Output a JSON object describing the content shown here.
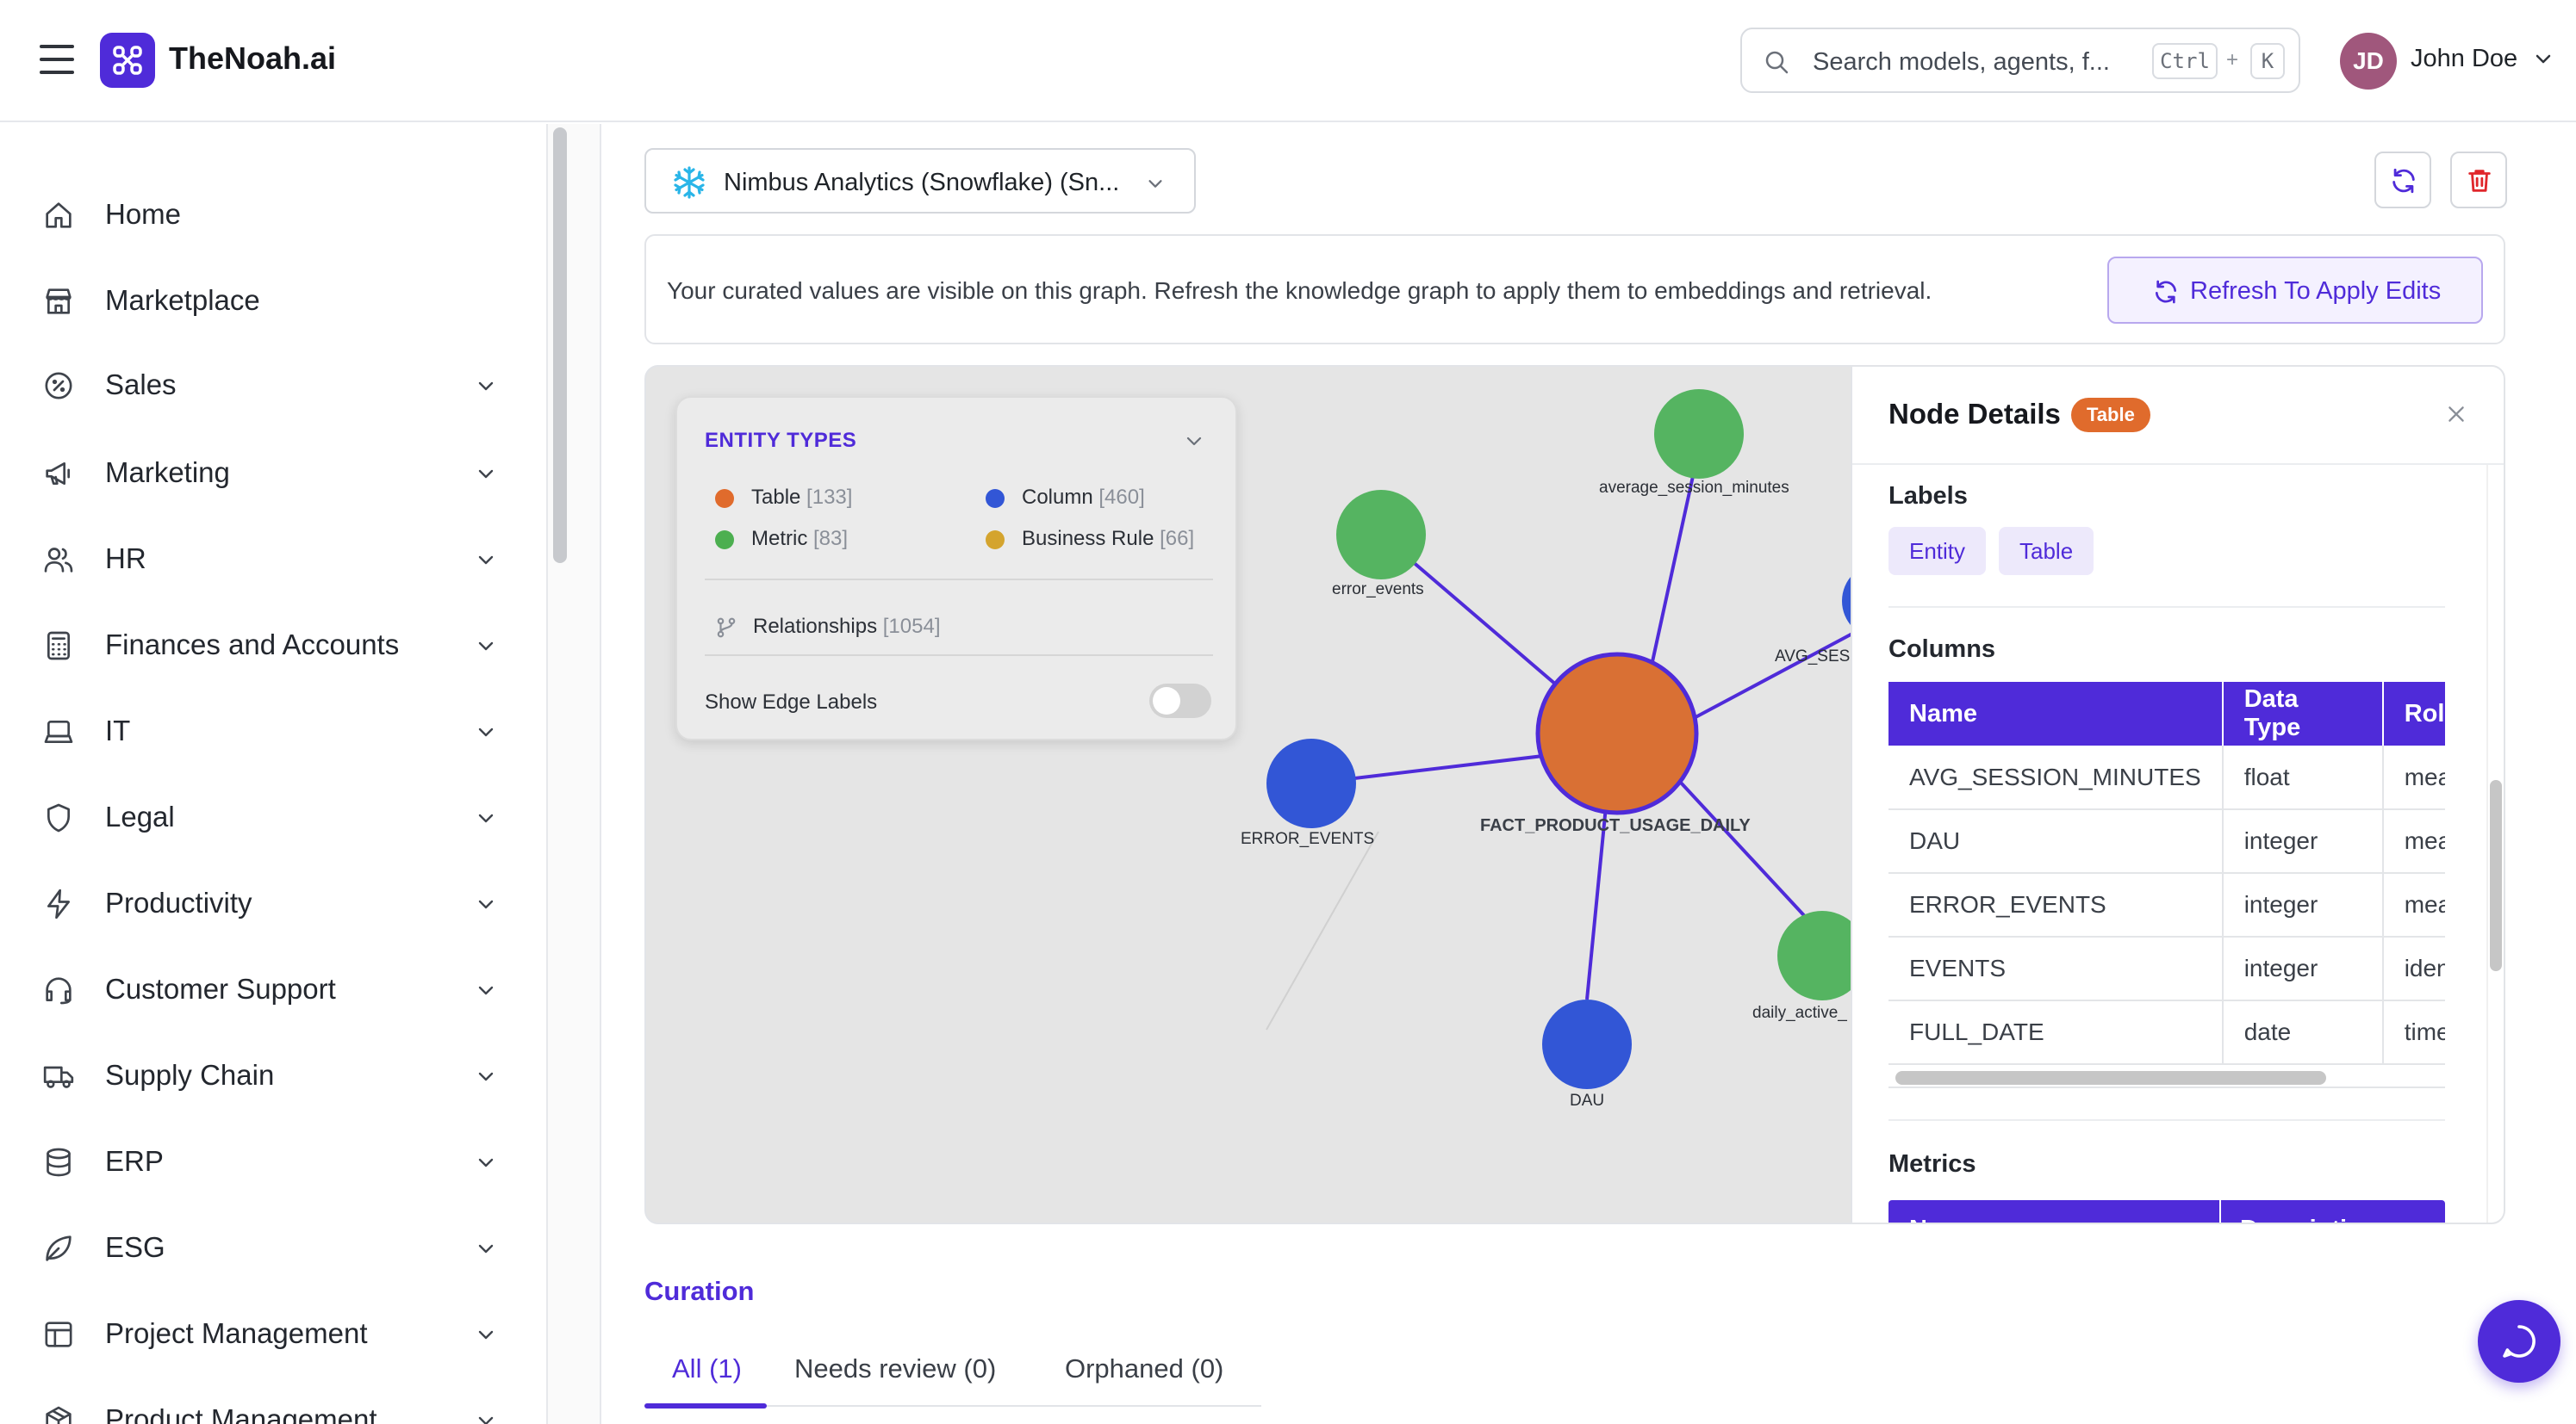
{
  "header": {
    "app_name": "TheNoah.ai",
    "search_placeholder": "Search models, agents, f...",
    "shortcut_ctrl": "Ctrl",
    "shortcut_plus": "+",
    "shortcut_key": "K",
    "user_initials": "JD",
    "user_name": "John Doe"
  },
  "sidebar": {
    "items": [
      {
        "label": "Home",
        "icon": "home-icon",
        "expandable": false
      },
      {
        "label": "Marketplace",
        "icon": "store-icon",
        "expandable": false
      },
      {
        "label": "Sales",
        "icon": "percent-badge-icon",
        "expandable": true
      },
      {
        "label": "Marketing",
        "icon": "megaphone-icon",
        "expandable": true
      },
      {
        "label": "HR",
        "icon": "users-icon",
        "expandable": true
      },
      {
        "label": "Finances and Accounts",
        "icon": "calculator-icon",
        "expandable": true
      },
      {
        "label": "IT",
        "icon": "laptop-icon",
        "expandable": true
      },
      {
        "label": "Legal",
        "icon": "shield-icon",
        "expandable": true
      },
      {
        "label": "Productivity",
        "icon": "lightning-icon",
        "expandable": true
      },
      {
        "label": "Customer Support",
        "icon": "headset-icon",
        "expandable": true
      },
      {
        "label": "Supply Chain",
        "icon": "truck-icon",
        "expandable": true
      },
      {
        "label": "ERP",
        "icon": "database-icon",
        "expandable": true
      },
      {
        "label": "ESG",
        "icon": "leaf-icon",
        "expandable": true
      },
      {
        "label": "Project Management",
        "icon": "layout-icon",
        "expandable": true
      },
      {
        "label": "Product Management",
        "icon": "box-icon",
        "expandable": true
      }
    ]
  },
  "toolbar": {
    "datasource": "Nimbus Analytics (Snowflake) (Sn..."
  },
  "notice": {
    "text": "Your curated values are visible on this graph. Refresh the knowledge graph to apply them to embeddings and retrieval.",
    "button": "Refresh To Apply Edits"
  },
  "legend": {
    "title": "ENTITY TYPES",
    "types": [
      {
        "name": "Table",
        "count": "[133]",
        "color": "#e06b2c"
      },
      {
        "name": "Column",
        "count": "[460]",
        "color": "#3256d6"
      },
      {
        "name": "Metric",
        "count": "[83]",
        "color": "#4caf50"
      },
      {
        "name": "Business Rule",
        "count": "[66]",
        "color": "#d4a42e"
      }
    ],
    "relationships_label": "Relationships",
    "relationships_count": "[1054]",
    "edge_labels_label": "Show Edge Labels",
    "edge_labels_enabled": false
  },
  "graph": {
    "nodes": [
      {
        "label": "FACT_PRODUCT_USAGE_DAILY",
        "type": "Table"
      },
      {
        "label": "average_session_minutes",
        "type": "Metric"
      },
      {
        "label": "error_events",
        "type": "Metric"
      },
      {
        "label": "AVG_SES",
        "type": "Column"
      },
      {
        "label": "ERROR_EVENTS",
        "type": "Column"
      },
      {
        "label": "daily_active_",
        "type": "Metric"
      },
      {
        "label": "DAU",
        "type": "Column"
      }
    ]
  },
  "details": {
    "title": "Node Details",
    "badge": "Table",
    "labels_title": "Labels",
    "labels": [
      "Entity",
      "Table"
    ],
    "columns_title": "Columns",
    "columns_headers": [
      "Name",
      "Data Type",
      "Role"
    ],
    "columns_rows": [
      [
        "AVG_SESSION_MINUTES",
        "float",
        "measure"
      ],
      [
        "DAU",
        "integer",
        "measure"
      ],
      [
        "ERROR_EVENTS",
        "integer",
        "measure"
      ],
      [
        "EVENTS",
        "integer",
        "identifier"
      ],
      [
        "FULL_DATE",
        "date",
        "time"
      ]
    ],
    "metrics_title": "Metrics",
    "metrics_headers": [
      "Name",
      "Description"
    ]
  },
  "curation": {
    "title": "Curation",
    "tabs": [
      "All (1)",
      "Needs review (0)",
      "Orphaned (0)"
    ]
  }
}
